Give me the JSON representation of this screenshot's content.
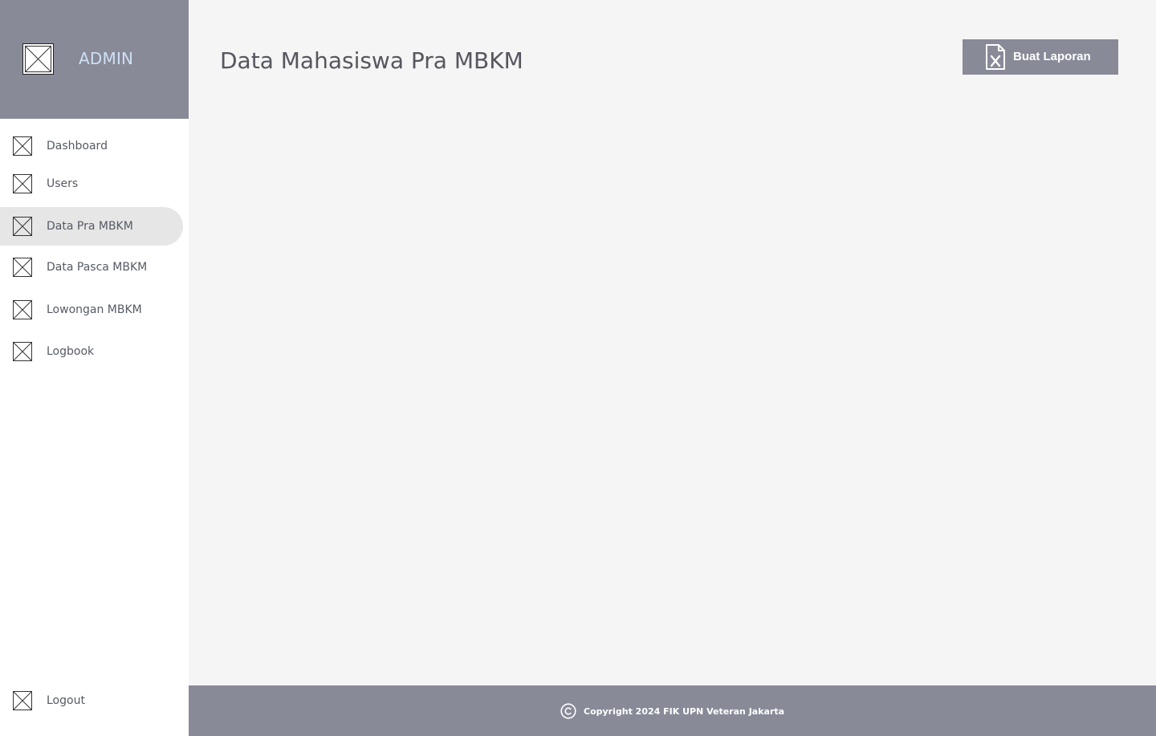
{
  "sidebar": {
    "brand": {
      "logo_icon": "image-placeholder-icon",
      "title": "ADMIN"
    },
    "items": [
      {
        "label": "Dashboard",
        "icon": "image-placeholder-icon",
        "active": false
      },
      {
        "label": "Users",
        "icon": "image-placeholder-icon",
        "active": false
      },
      {
        "label": "Data Pra MBKM",
        "icon": "image-placeholder-icon",
        "active": true
      },
      {
        "label": "Data Pasca MBKM",
        "icon": "image-placeholder-icon",
        "active": false
      },
      {
        "label": "Lowongan MBKM",
        "icon": "image-placeholder-icon",
        "active": false
      },
      {
        "label": "Logbook",
        "icon": "image-placeholder-icon",
        "active": false
      }
    ],
    "logout": {
      "label": "Logout",
      "icon": "image-placeholder-icon"
    }
  },
  "main": {
    "title": "Data Mahasiswa Pra MBKM",
    "report_button": {
      "label": "Buat Laporan",
      "icon": "excel-file-icon"
    }
  },
  "footer": {
    "icon": "copyright-icon",
    "text": "Copyright 2024 FIK UPN Veteran Jakarta"
  },
  "colors": {
    "sidebar_header": "#888a98",
    "brand_title": "#cfe0f5",
    "active_item": "#e6e6e6",
    "content_bg": "#f5f5f5",
    "footer": "#888a98",
    "button": "#888a98"
  }
}
